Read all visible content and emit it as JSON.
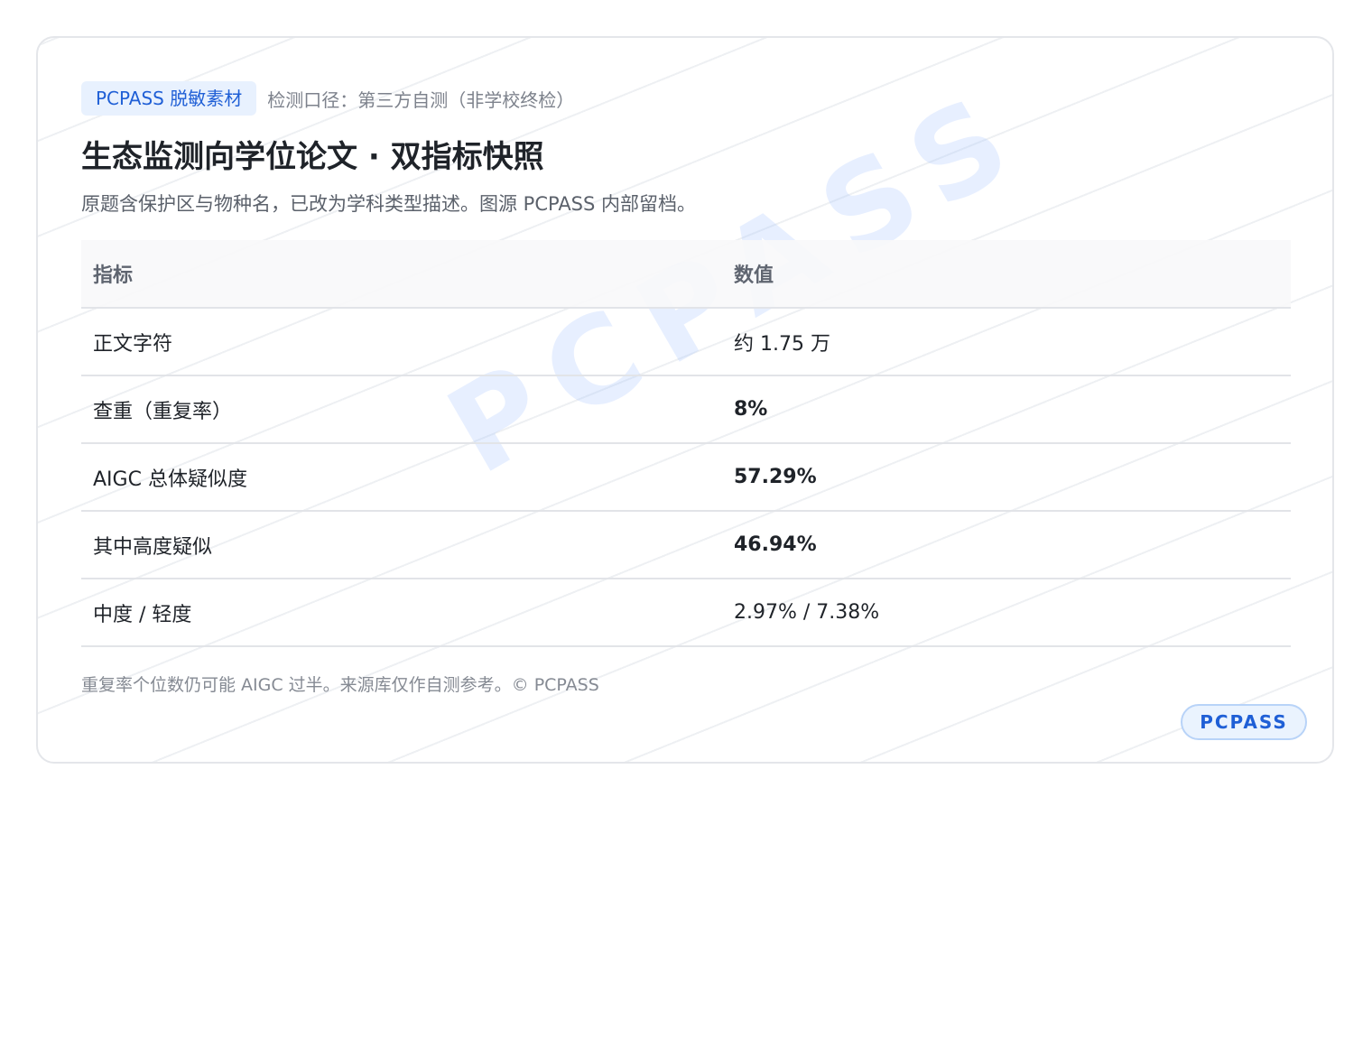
{
  "header": {
    "tag": "PCPASS 脱敏素材",
    "scope": "检测口径：第三方自测（非学校终检）",
    "title": "生态监测向学位论文 · 双指标快照",
    "subtitle": "原题含保护区与物种名，已改为学科类型描述。图源 PCPASS 内部留档。"
  },
  "watermark": "PCPASS",
  "table": {
    "headers": [
      "指标",
      "数值"
    ],
    "rows": [
      {
        "label": "正文字符",
        "value": "约 1.75 万",
        "style": "normal"
      },
      {
        "label": "查重（重复率）",
        "value": "8%",
        "style": "green"
      },
      {
        "label": "AIGC 总体疑似度",
        "value": "57.29%",
        "style": "red"
      },
      {
        "label": "其中高度疑似",
        "value": "46.94%",
        "style": "red"
      },
      {
        "label": "中度 / 轻度",
        "value": "2.97% / 7.38%",
        "style": "normal"
      }
    ]
  },
  "footer": {
    "note": "重复率个位数仍可能 AIGC 过半。来源库仅作自测参考。© PCPASS",
    "badge": "PCPASS"
  },
  "colors": {
    "accent": "#1f5fd6",
    "green": "#3a9a12",
    "red": "#d2401c"
  }
}
